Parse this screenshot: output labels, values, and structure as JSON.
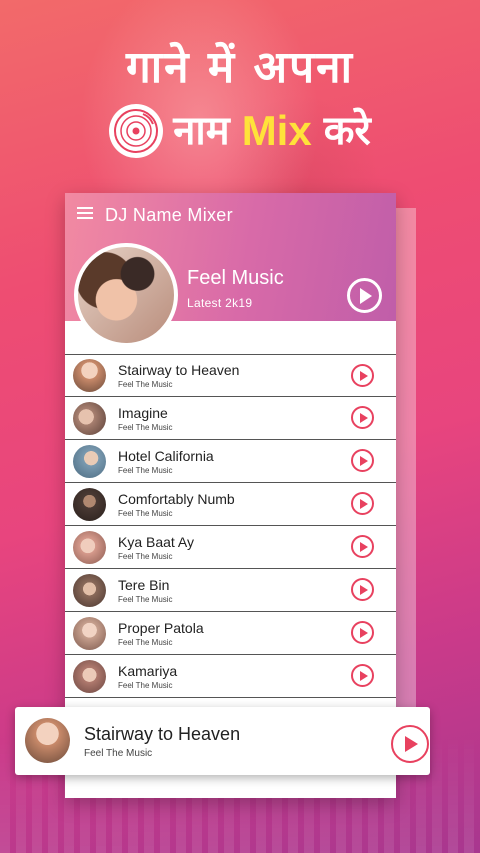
{
  "promo": {
    "line1": "गाने में अपना",
    "line2_left": "नाम",
    "line2_highlight": "Mix",
    "line2_right": "करे",
    "disc_icon": "vinyl-disc-icon",
    "highlight_color": "#ffe23a"
  },
  "app": {
    "title": "DJ Name Mixer",
    "menu_icon": "hamburger-menu-icon",
    "accent_color": "#e8415f"
  },
  "hero": {
    "title": "Feel Music",
    "subtitle": "Latest 2k19"
  },
  "songs": [
    {
      "title": "Stairway to Heaven",
      "artist": "Feel The Music",
      "thumb": "#c98a6a"
    },
    {
      "title": "Imagine",
      "artist": "Feel The Music",
      "thumb": "#a88070"
    },
    {
      "title": "Hotel California",
      "artist": "Feel The Music",
      "thumb": "#7a9ab0"
    },
    {
      "title": "Comfortably Numb",
      "artist": "Feel The Music",
      "thumb": "#4a3a34"
    },
    {
      "title": "Kya Baat Ay",
      "artist": "Feel The Music",
      "thumb": "#d69a8c"
    },
    {
      "title": "Tere Bin",
      "artist": "Feel The Music",
      "thumb": "#8a6a5a"
    },
    {
      "title": "Proper Patola",
      "artist": "Feel The Music",
      "thumb": "#c7a08e"
    },
    {
      "title": "Kamariya",
      "artist": "Feel The Music",
      "thumb": "#b07a6e"
    }
  ],
  "now_playing": {
    "title": "Stairway to Heaven",
    "artist": "Feel The Music"
  }
}
